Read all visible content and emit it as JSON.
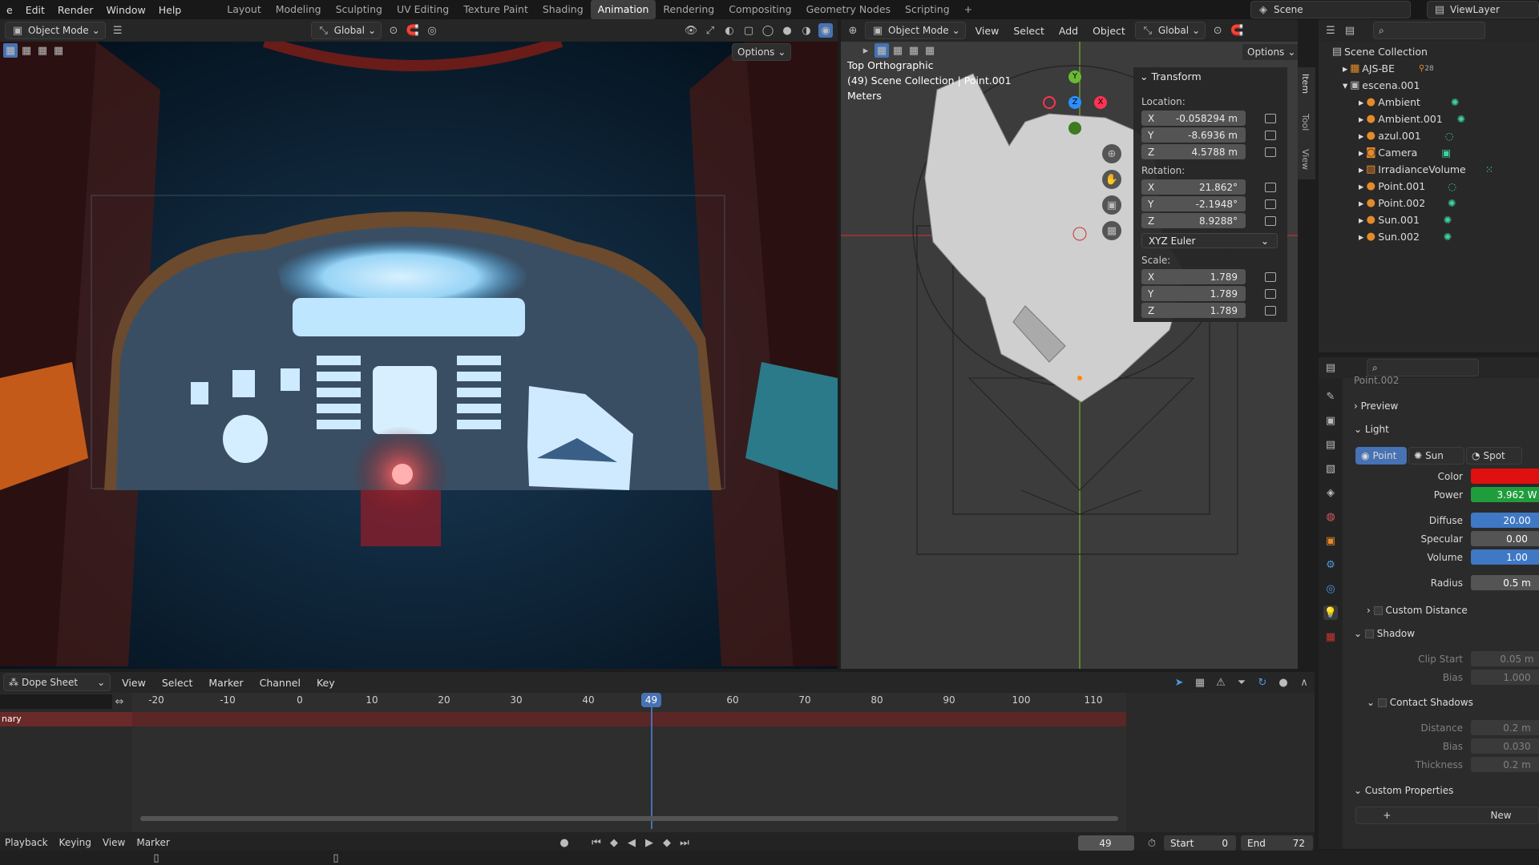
{
  "topbar": {
    "menus": [
      "e",
      "Edit",
      "Render",
      "Window",
      "Help"
    ],
    "workspaces": [
      "Layout",
      "Modeling",
      "Sculpting",
      "UV Editing",
      "Texture Paint",
      "Shading",
      "Animation",
      "Rendering",
      "Compositing",
      "Geometry Nodes",
      "Scripting"
    ],
    "active_workspace": "Animation",
    "add_tab": "+",
    "scene": "Scene",
    "view_layer": "ViewLayer"
  },
  "left_viewport": {
    "mode": "Object Mode",
    "orientation": "Global",
    "options": "Options"
  },
  "right_viewport": {
    "mode": "Object Mode",
    "menus": [
      "View",
      "Select",
      "Add",
      "Object"
    ],
    "orientation": "Global",
    "options": "Options",
    "overlay_title": "Top Orthographic",
    "overlay_collection": "(49) Scene Collection | Point.001",
    "overlay_units": "Meters",
    "side_tabs": [
      "Item",
      "Tool",
      "View"
    ],
    "gizmo": {
      "y": "Y",
      "z": "Z",
      "x": "X"
    }
  },
  "transform": {
    "title": "Transform",
    "location_label": "Location:",
    "location": {
      "X": "-0.058294 m",
      "Y": "-8.6936 m",
      "Z": "4.5788 m"
    },
    "rotation_label": "Rotation:",
    "rotation": {
      "X": "21.862°",
      "Y": "-2.1948°",
      "Z": "8.9288°"
    },
    "rotation_mode": "XYZ Euler",
    "scale_label": "Scale:",
    "scale": {
      "X": "1.789",
      "Y": "1.789",
      "Z": "1.789"
    },
    "axis": {
      "x": "X",
      "y": "Y",
      "z": "Z"
    }
  },
  "outliner": {
    "root": "Scene Collection",
    "items": [
      {
        "label": "AJS-BE",
        "extra": "28"
      },
      {
        "label": "escena.001"
      },
      {
        "label": "Ambient"
      },
      {
        "label": "Ambient.001"
      },
      {
        "label": "azul.001"
      },
      {
        "label": "Camera"
      },
      {
        "label": "IrradianceVolume"
      },
      {
        "label": "Point.001"
      },
      {
        "label": "Point.002"
      },
      {
        "label": "Sun.001"
      },
      {
        "label": "Sun.002"
      }
    ]
  },
  "properties": {
    "object_name": "Point.002",
    "preview": "Preview",
    "light": "Light",
    "light_types": [
      "Point",
      "Sun",
      "Spot"
    ],
    "color_label": "Color",
    "color_value": "#e01010",
    "power_label": "Power",
    "power": "3.962 W",
    "diffuse_label": "Diffuse",
    "diffuse": "20.00",
    "specular_label": "Specular",
    "specular": "0.00",
    "volume_label": "Volume",
    "volume": "1.00",
    "radius_label": "Radius",
    "radius": "0.5 m",
    "custom_distance": "Custom Distance",
    "shadow": "Shadow",
    "clip_start_label": "Clip Start",
    "clip_start": "0.05 m",
    "bias_label": "Bias",
    "bias": "1.000",
    "contact_shadows": "Contact Shadows",
    "distance_label": "Distance",
    "distance": "0.2 m",
    "cbias_label": "Bias",
    "cbias": "0.030",
    "thickness_label": "Thickness",
    "thickness": "0.2 m",
    "custom_properties": "Custom Properties",
    "new": "New",
    "new_plus": "+"
  },
  "dopesheet": {
    "editor": "Dope Sheet",
    "menus": [
      "View",
      "Select",
      "Marker",
      "Channel",
      "Key"
    ],
    "channel": "nary",
    "ticks": [
      "-20",
      "-10",
      "0",
      "10",
      "20",
      "30",
      "40",
      "60",
      "70",
      "80",
      "90",
      "100",
      "110"
    ],
    "current_frame": "49"
  },
  "playback": {
    "menus": [
      "Playback",
      "Keying",
      "View",
      "Marker"
    ],
    "frame": "49",
    "start_label": "Start",
    "start": "0",
    "end_label": "End",
    "end": "72"
  }
}
